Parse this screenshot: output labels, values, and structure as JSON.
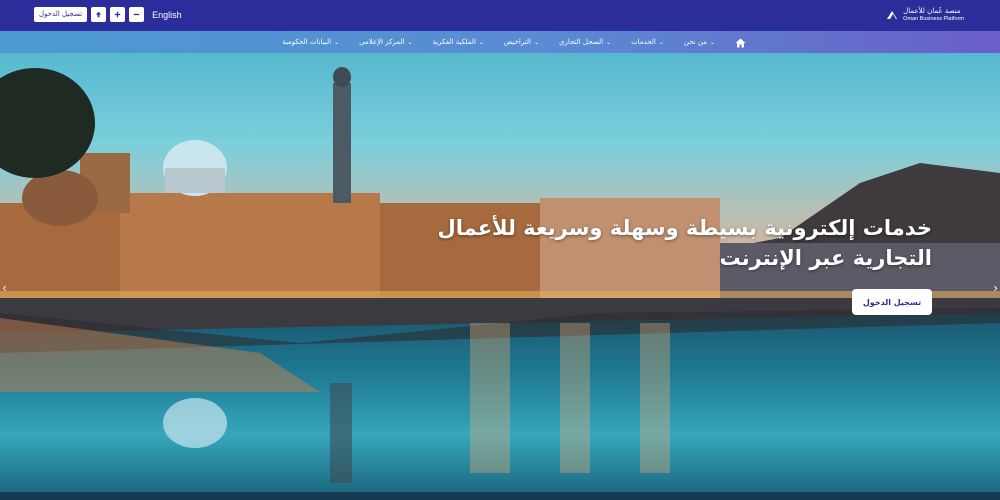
{
  "top_bar": {
    "login_label": "تسجيل الدخول",
    "language_label": "English",
    "logo_arabic": "منصة عُمان للأعمال",
    "logo_english": "Oman Business Platform"
  },
  "nav": {
    "items": [
      {
        "label": "من نحن"
      },
      {
        "label": "الخدمات"
      },
      {
        "label": "السجل التجاري"
      },
      {
        "label": "التراخيص"
      },
      {
        "label": "الملكية الفكرية"
      },
      {
        "label": "المركز الإعلامي"
      },
      {
        "label": "البيانات الحكومية"
      }
    ]
  },
  "hero": {
    "headline_line1": "خدمات إلكترونية بسيطة وسهلة وسريعة للأعمال",
    "headline_line2": "التجارية عبر الإنترنت",
    "login_button": "تسجيل الدخول"
  },
  "colors": {
    "top_bar": "#2b2e9a",
    "nav_start": "#4c9ad1",
    "nav_end": "#6a5ec8"
  },
  "icons": [
    "home-icon",
    "chevron-down-icon",
    "arrow-left-icon",
    "arrow-right-icon",
    "font-size-icon",
    "font-decrease-icon"
  ]
}
